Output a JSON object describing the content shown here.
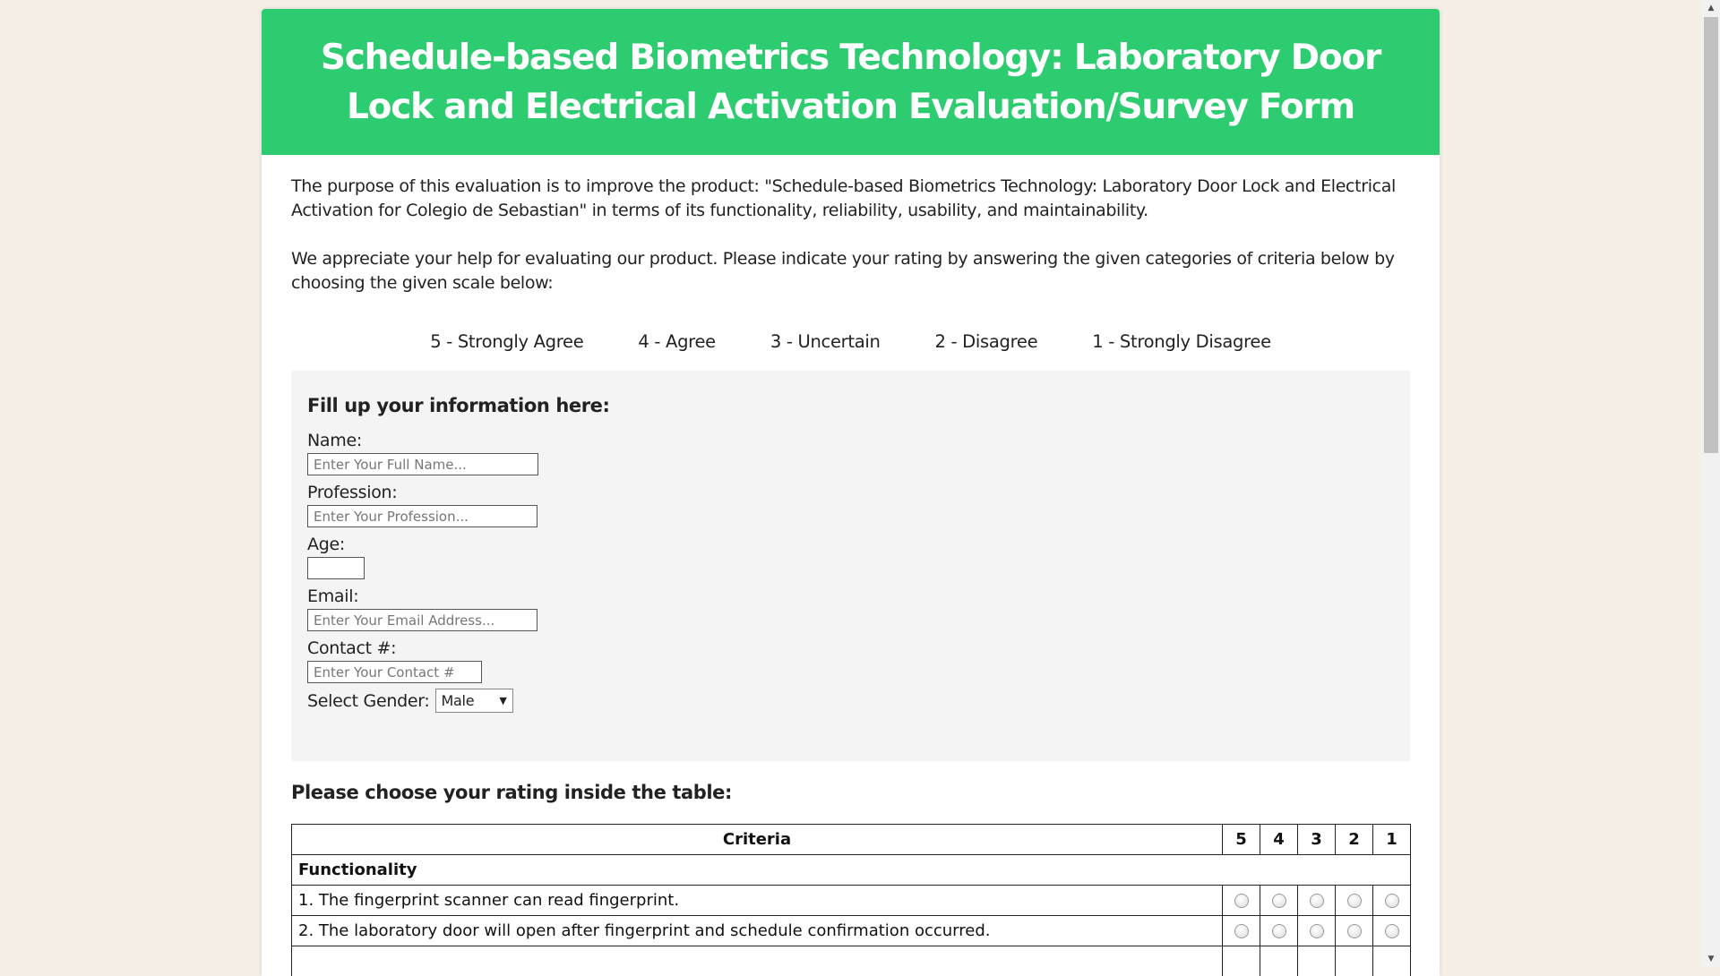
{
  "header": {
    "title": "Schedule-based Biometrics Technology: Laboratory Door Lock and Electrical Activation Evaluation/Survey Form"
  },
  "intro": {
    "paragraph1": "The purpose of this evaluation is to improve the product: \"Schedule-based Biometrics Technology: Laboratory Door Lock and Electrical Activation for Colegio de Sebastian\" in terms of its functionality, reliability, usability, and maintainability.",
    "paragraph2": "We appreciate your help for evaluating our product. Please indicate your rating by answering the given categories of criteria below by choosing the given scale below:"
  },
  "scale": [
    "5 - Strongly Agree",
    "4 - Agree",
    "3 - Uncertain",
    "2 - Disagree",
    "1 - Strongly Disagree"
  ],
  "info_form": {
    "title": "Fill up your information here:",
    "name_label": "Name:",
    "name_placeholder": "Enter Your Full Name...",
    "profession_label": "Profession:",
    "profession_placeholder": "Enter Your Profession...",
    "age_label": "Age:",
    "email_label": "Email:",
    "email_placeholder": "Enter Your Email Address...",
    "contact_label": "Contact #:",
    "contact_placeholder": "Enter Your Contact #",
    "gender_label": "Select Gender:",
    "gender_value": "Male"
  },
  "rating": {
    "title": "Please choose your rating inside the table:",
    "header_criteria": "Criteria",
    "header_scores": [
      "5",
      "4",
      "3",
      "2",
      "1"
    ],
    "category": "Functionality",
    "rows": [
      "1. The fingerprint scanner can read fingerprint.",
      "2. The laboratory door will open after fingerprint and schedule confirmation occurred."
    ]
  },
  "colors": {
    "header_bg": "#2ecc71",
    "page_bg": "#f5efe6",
    "info_box_bg": "#f4f4f4"
  }
}
